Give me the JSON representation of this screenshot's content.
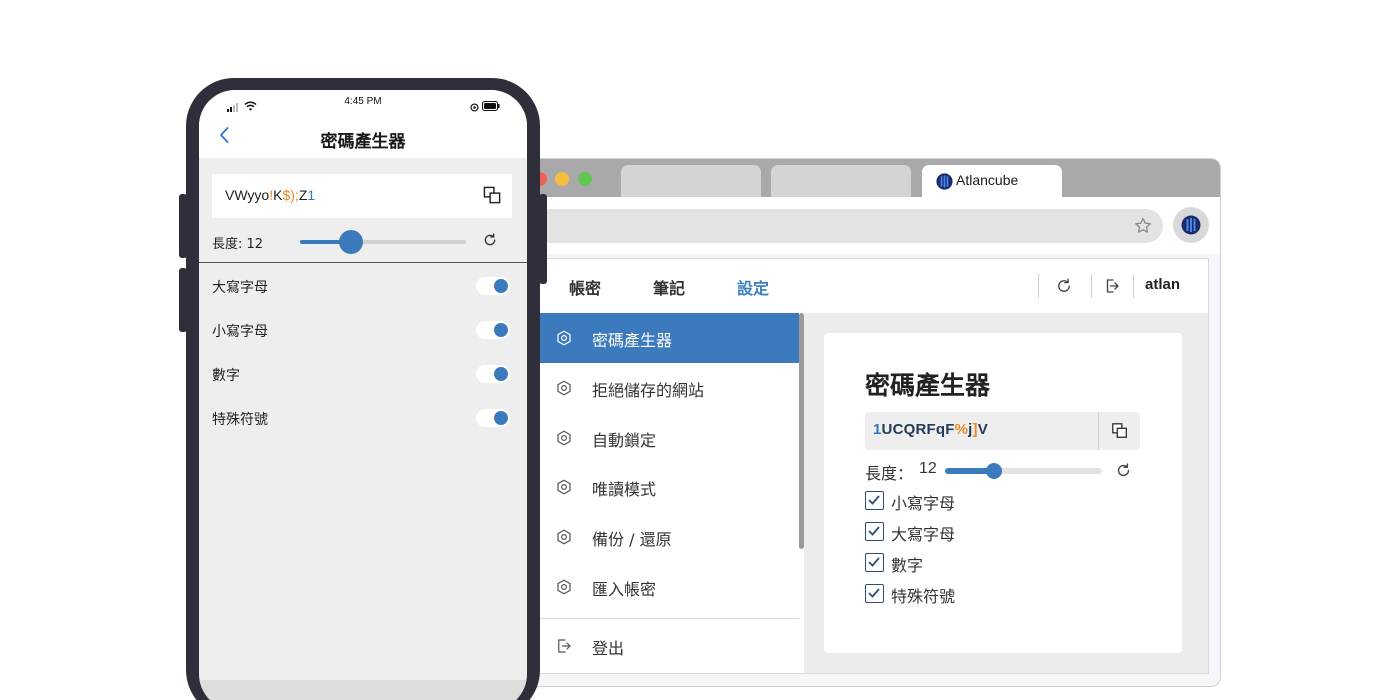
{
  "browser": {
    "tabs": [
      {
        "label": ""
      },
      {
        "label": ""
      },
      {
        "label": "Atlancube",
        "active": true
      }
    ],
    "url": "",
    "icons": {
      "bookmark": "star-icon",
      "extension": "atlancube-logo-icon"
    }
  },
  "app": {
    "nav": {
      "items": [
        {
          "label": "帳密"
        },
        {
          "label": "筆記"
        },
        {
          "label": "設定",
          "active": true
        }
      ],
      "user": "atlan"
    },
    "menu": {
      "items": [
        {
          "label": "密碼產生器",
          "active": true
        },
        {
          "label": "拒絕儲存的網站"
        },
        {
          "label": "自動鎖定"
        },
        {
          "label": "唯讀模式"
        },
        {
          "label": "備份 / 還原"
        },
        {
          "label": "匯入帳密"
        }
      ],
      "logout": "登出"
    },
    "generator": {
      "title": "密碼產生器",
      "password_parts": [
        {
          "t": "1",
          "c": "blue"
        },
        {
          "t": "UCQRFqF",
          "c": "plain"
        },
        {
          "t": "%",
          "c": "orange"
        },
        {
          "t": "j",
          "c": "plain"
        },
        {
          "t": "]",
          "c": "orange"
        },
        {
          "t": "V",
          "c": "plain"
        }
      ],
      "length_label": "長度：",
      "length_value": "12",
      "length_fraction": 0.31,
      "options": [
        {
          "label": "小寫字母",
          "checked": true
        },
        {
          "label": "大寫字母",
          "checked": true
        },
        {
          "label": "數字",
          "checked": true
        },
        {
          "label": "特殊符號",
          "checked": true
        }
      ]
    }
  },
  "phone": {
    "time": "4:45 PM",
    "title": "密碼產生器",
    "password_parts": [
      {
        "t": "VWyyo",
        "c": "plain"
      },
      {
        "t": "!",
        "c": "orange"
      },
      {
        "t": "K",
        "c": "plain"
      },
      {
        "t": "$",
        "c": "orange"
      },
      {
        "t": ")",
        "c": "orange"
      },
      {
        "t": ";",
        "c": "orange"
      },
      {
        "t": "Z",
        "c": "plain"
      },
      {
        "t": "1",
        "c": "blue"
      }
    ],
    "length_label": "長度: 12",
    "length_fraction": 0.31,
    "options": [
      {
        "label": "大寫字母",
        "on": true
      },
      {
        "label": "小寫字母",
        "on": true
      },
      {
        "label": "數字",
        "on": true
      },
      {
        "label": "特殊符號",
        "on": true
      }
    ]
  },
  "colors": {
    "accent": "#3b7abd",
    "special_char": "#e98a24",
    "digit": "#2f77c6"
  }
}
